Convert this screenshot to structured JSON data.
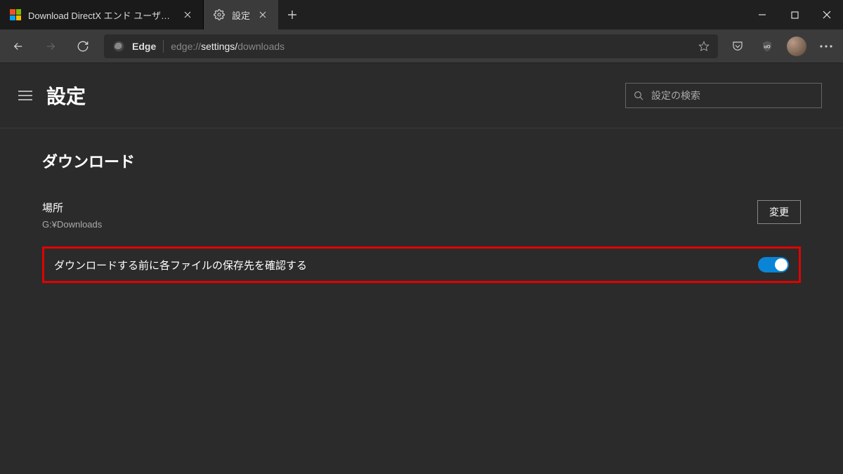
{
  "tabs": [
    {
      "title": "Download DirectX エンド ユーザー ラ"
    },
    {
      "title": "設定"
    }
  ],
  "addressbar": {
    "browser_label": "Edge",
    "url_prefix": "edge://",
    "url_strong": "settings/",
    "url_rest": "downloads"
  },
  "settings": {
    "page_title": "設定",
    "search_placeholder": "設定の検索",
    "section_title": "ダウンロード",
    "location_label": "場所",
    "location_value": "G:¥Downloads",
    "change_button": "変更",
    "ask_before_label": "ダウンロードする前に各ファイルの保存先を確認する"
  }
}
